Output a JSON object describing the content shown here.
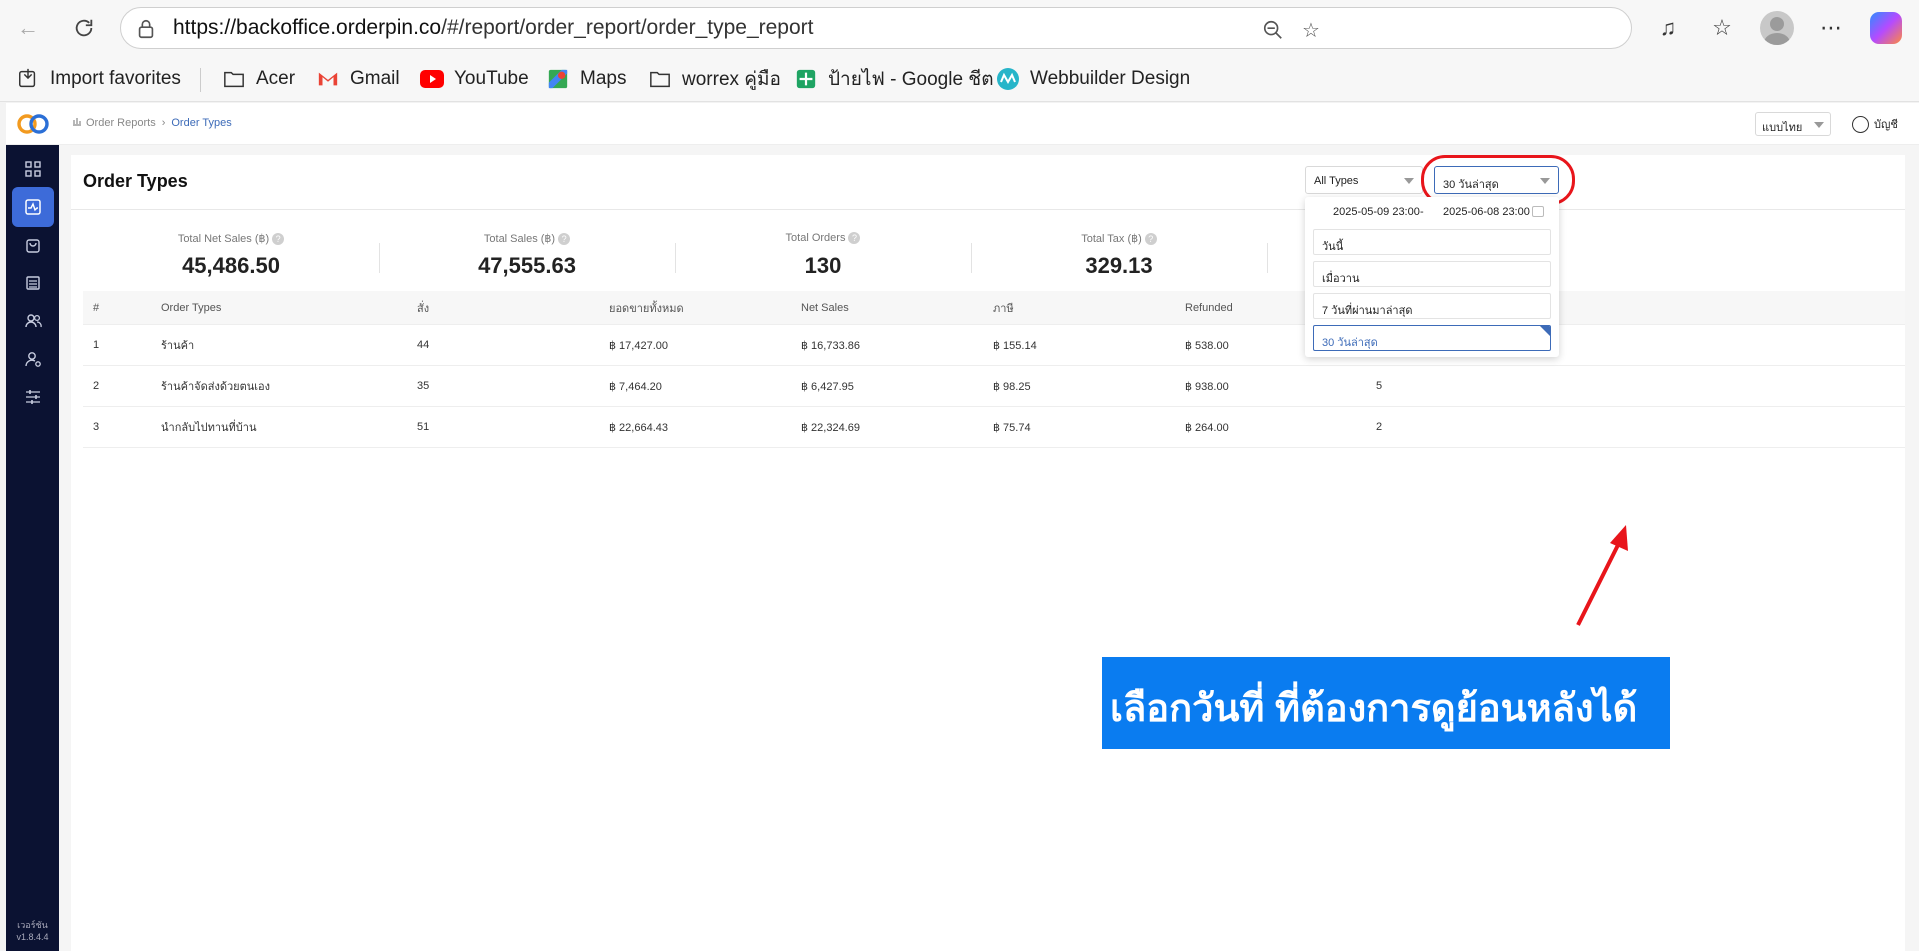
{
  "browser": {
    "url_host": "https://backoffice.orderpin.co",
    "url_path": "/#/report/order_report/order_type_report",
    "bookmarks": [
      {
        "label": "Import favorites",
        "icon": "import-icon"
      },
      {
        "label": "Acer",
        "icon": "folder-icon"
      },
      {
        "label": "Gmail",
        "icon": "gmail-icon"
      },
      {
        "label": "YouTube",
        "icon": "youtube-icon"
      },
      {
        "label": "Maps",
        "icon": "maps-icon"
      },
      {
        "label": "worrex คู่มือ",
        "icon": "folder-icon"
      },
      {
        "label": "ป้ายไฟ - Google ชีต",
        "icon": "sheets-icon"
      },
      {
        "label": "Webbuilder Design",
        "icon": "webbuilder-icon"
      }
    ]
  },
  "header": {
    "breadcrumb": [
      "Order Reports",
      "Order Types"
    ],
    "language": "แบบไทย",
    "account": "บัญชี"
  },
  "sidebar": {
    "items": [
      {
        "icon": "dashboard-icon"
      },
      {
        "icon": "report-icon",
        "active": true
      },
      {
        "icon": "shopping-bag-icon"
      },
      {
        "icon": "catalog-icon"
      },
      {
        "icon": "customers-icon"
      },
      {
        "icon": "staff-icon"
      },
      {
        "icon": "settings-sliders-icon"
      }
    ],
    "version_label": "เวอร์ชัน",
    "version": "v1.8.4.4"
  },
  "page": {
    "title": "Order Types",
    "type_filter": "All Types",
    "range_filter": "30 วันล่าสุด"
  },
  "stats": [
    {
      "label": "Total Net Sales (฿)",
      "value": "45,486.50"
    },
    {
      "label": "Total Sales (฿)",
      "value": "47,555.63"
    },
    {
      "label": "Total Orders",
      "value": "130"
    },
    {
      "label": "Total Tax (฿)",
      "value": "329.13"
    }
  ],
  "table": {
    "columns": [
      "#",
      "Order Types",
      "สั่ง",
      "ยอดขายทั้งหมด",
      "Net Sales",
      "ภาษี",
      "Refunded"
    ],
    "rows": [
      {
        "no": "1",
        "type": "ร้านค้า",
        "orders": "44",
        "total": "฿ 17,427.00",
        "net": "฿ 16,733.86",
        "tax": "฿ 155.14",
        "refunded": "฿ 538.00",
        "extra": ""
      },
      {
        "no": "2",
        "type": "ร้านค้าจัดส่งด้วยตนเอง",
        "orders": "35",
        "total": "฿ 7,464.20",
        "net": "฿ 6,427.95",
        "tax": "฿ 98.25",
        "refunded": "฿ 938.00",
        "extra": "5"
      },
      {
        "no": "3",
        "type": "นำกลับไปทานที่บ้าน",
        "orders": "51",
        "total": "฿ 22,664.43",
        "net": "฿ 22,324.69",
        "tax": "฿ 75.74",
        "refunded": "฿ 264.00",
        "extra": "2"
      }
    ]
  },
  "dropdown": {
    "start_date": "2025-05-09 23:00",
    "separator": "-",
    "end_date": "2025-06-08 23:00",
    "options": [
      "วันนี้",
      "เมื่อวาน",
      "7 วันที่ผ่านมาล่าสุด",
      "30 วันล่าสุด"
    ],
    "selected_index": 3
  },
  "annotation": {
    "callout_text": "เลือกวันที่ ที่ต้องการดูย้อนหลังได้",
    "callout_color": "#0a7cf0",
    "highlight_color": "#e8151b"
  }
}
